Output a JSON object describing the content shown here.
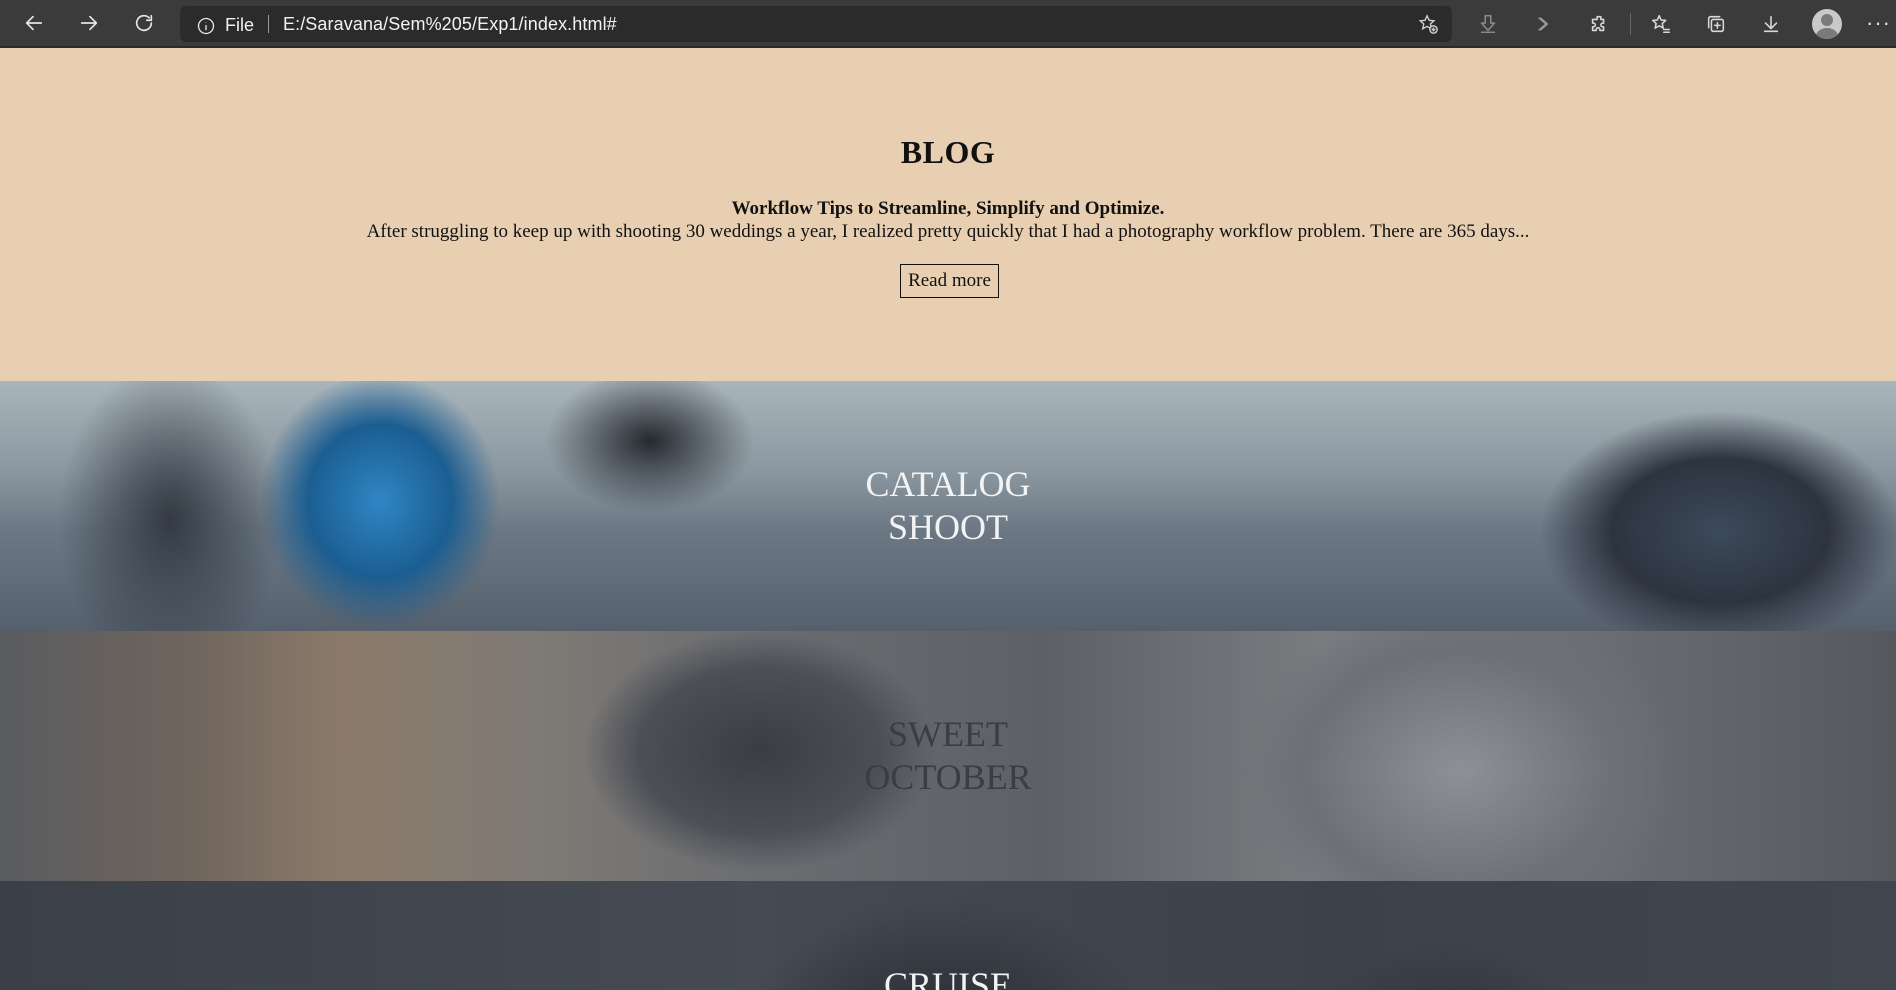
{
  "browser": {
    "back_icon": "arrow-left-icon",
    "forward_icon": "arrow-right-icon",
    "refresh_icon": "refresh-icon",
    "site_info_icon": "info-circle-icon",
    "site_label": "File",
    "url": "E:/Saravana/Sem%205/Exp1/index.html#",
    "toolbar_icons": [
      "add-favorite-icon",
      "download-arrow-icon",
      "play-chevron-icon",
      "extensions-icon",
      "favorites-icon",
      "collections-icon",
      "downloads-icon",
      "profile-avatar",
      "more-options-icon"
    ]
  },
  "blog": {
    "title": "BLOG",
    "post_title": "Workflow Tips to Streamline, Simplify and Optimize.",
    "post_excerpt": "After struggling to keep up with shooting 30 weddings a year, I realized pretty quickly that I had a photography workflow problem. There are 365 days...",
    "read_more_label": "Read more"
  },
  "sections": [
    {
      "line1": "CATALOG",
      "line2": "SHOOT"
    },
    {
      "line1": "SWEET",
      "line2": "OCTOBER"
    },
    {
      "line1": "CRUISE",
      "line2": ""
    }
  ]
}
